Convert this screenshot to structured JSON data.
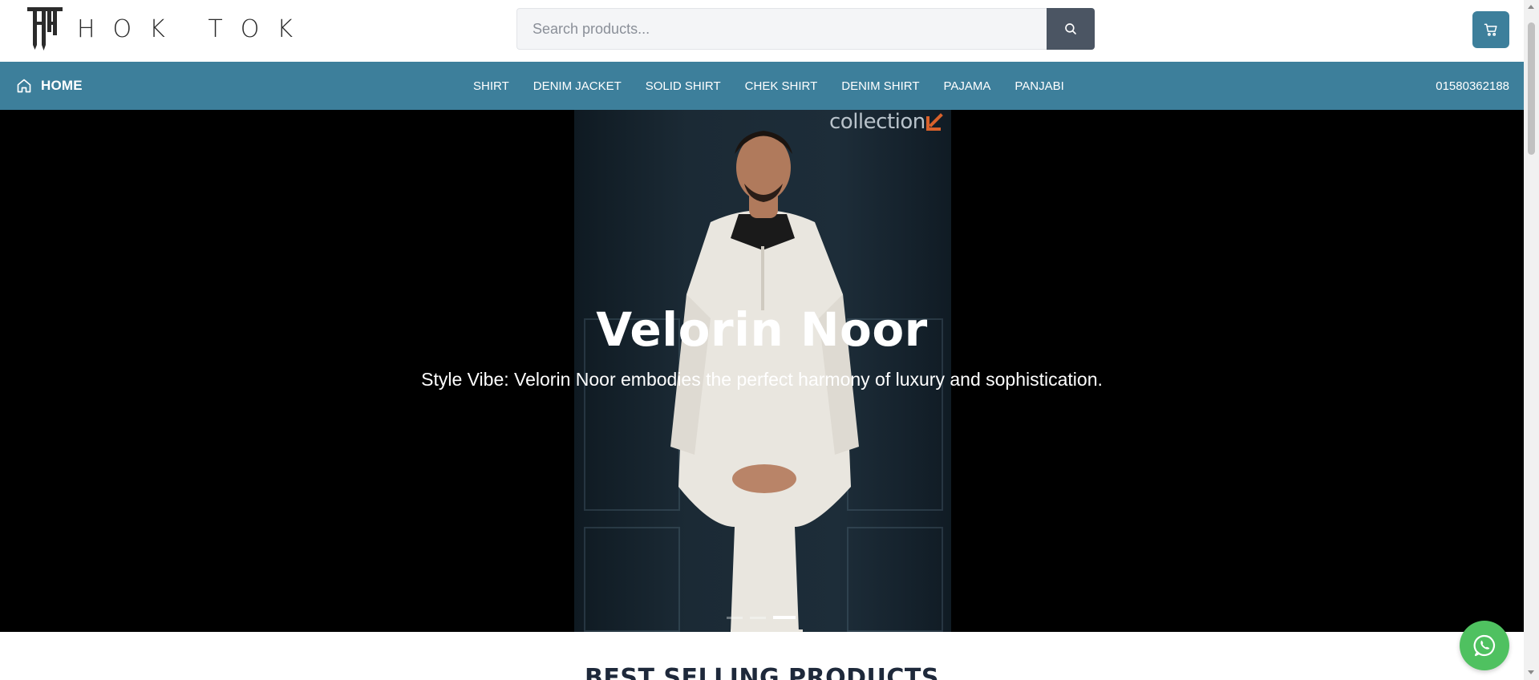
{
  "header": {
    "logo_text": "HOK TOK",
    "search": {
      "placeholder": "Search products...",
      "value": ""
    },
    "icons": {
      "search": "search-icon",
      "cart": "cart-icon"
    }
  },
  "nav": {
    "home_label": "HOME",
    "links": [
      "SHIRT",
      "DENIM JACKET",
      "SOLID SHIRT",
      "CHEK SHIRT",
      "DENIM SHIRT",
      "PAJAMA",
      "PANJABI"
    ],
    "phone": "01580362188",
    "icons": {
      "home": "home-icon"
    }
  },
  "hero": {
    "collection_text": "collection",
    "title": "Velorin Noor",
    "subtitle": "Style Vibe: Velorin Noor embodies the perfect harmony of luxury and sophistication.",
    "slide_count": 3,
    "active_slide": 3
  },
  "sections": {
    "best_selling_title": "BEST SELLING PRODUCTS"
  },
  "floating": {
    "whatsapp_icon": "whatsapp-icon"
  },
  "colors": {
    "nav_bg": "#3d7f9b",
    "cart_bg": "#3d7f9b",
    "search_button_bg": "#4b5563",
    "whatsapp_bg": "#4fc160",
    "hero_bg": "#000000",
    "collection_arrow": "#d9612b"
  }
}
